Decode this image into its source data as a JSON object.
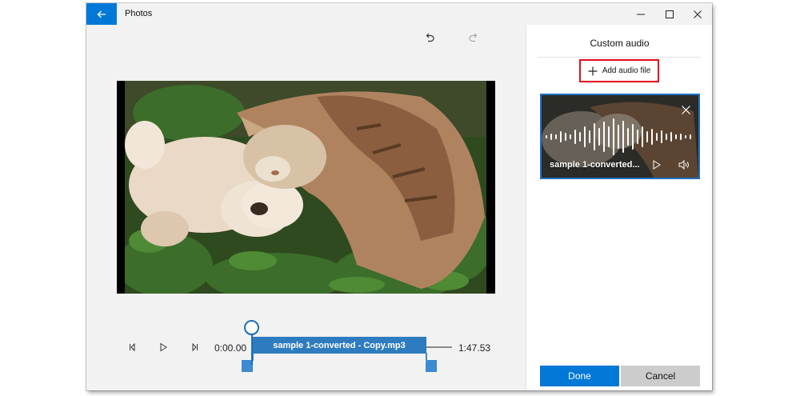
{
  "window": {
    "title": "Photos",
    "accent_color": "#0078d7",
    "icons": [
      "back-arrow-icon",
      "minimize-icon",
      "maximize-icon",
      "close-icon"
    ]
  },
  "toolbar": {
    "icons": [
      "undo-icon",
      "redo-icon"
    ]
  },
  "timeline": {
    "current_time": "0:00.00",
    "total_time": "1:47.53",
    "clip_label": "sample 1-converted - Copy.mp3",
    "icons": [
      "previous-frame-icon",
      "play-icon",
      "next-frame-icon"
    ]
  },
  "panel": {
    "title": "Custom audio",
    "add_audio_label": "Add audio file",
    "card": {
      "name": "sample 1-converted...",
      "icons": [
        "remove-icon",
        "play-icon",
        "volume-icon"
      ]
    },
    "done_label": "Done",
    "cancel_label": "Cancel"
  }
}
